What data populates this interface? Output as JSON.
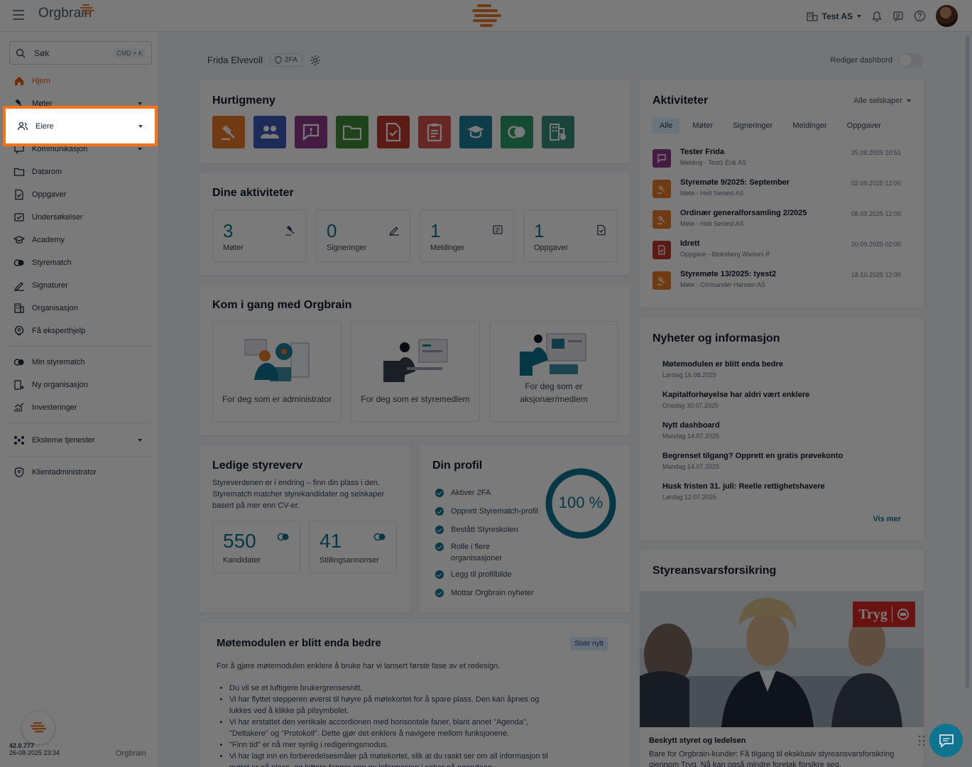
{
  "header": {
    "brand": "Orgbrain",
    "company": "Test AS"
  },
  "sidebar": {
    "search_label": "Søk",
    "search_shortcut": "CMD + K",
    "items": [
      {
        "label": "Hjem"
      },
      {
        "label": "Møter"
      },
      {
        "label": "Eiere"
      },
      {
        "label": "Kommunikasjon"
      },
      {
        "label": "Datarom"
      },
      {
        "label": "Oppgaver"
      },
      {
        "label": "Undersøkelser"
      },
      {
        "label": "Academy"
      },
      {
        "label": "Styrematch"
      },
      {
        "label": "Signaturer"
      },
      {
        "label": "Organisasjon"
      },
      {
        "label": "Få eksperthjelp"
      }
    ],
    "secondary": [
      {
        "label": "Min styrematch"
      },
      {
        "label": "Ny organisasjon"
      },
      {
        "label": "Investeringer"
      }
    ],
    "external": "Eksterne tjenester",
    "client_admin": "Klientadministrator",
    "version": "42.0.777",
    "build_time": "26-08-2025 23:34",
    "footer_brand": "Orgbrain"
  },
  "user": {
    "name": "Frida Elvevoll",
    "twofa": "2FA",
    "edit_dashboard": "Rediger dashbord"
  },
  "quickmenu": {
    "title": "Hurtigmeny",
    "colors": [
      "#ea7b27",
      "#3b5bb8",
      "#8e3a8c",
      "#3f8c3a",
      "#c0392b",
      "#d9534f",
      "#1e7f99",
      "#2a9d6a",
      "#3a8f7f"
    ]
  },
  "my_activities": {
    "title": "Dine aktiviteter",
    "stats": [
      {
        "value": "3",
        "label": "Møter"
      },
      {
        "value": "0",
        "label": "Signeringer"
      },
      {
        "value": "1",
        "label": "Meldinger"
      },
      {
        "value": "1",
        "label": "Oppgaver"
      }
    ]
  },
  "get_started": {
    "title": "Kom i gang med Orgbrain",
    "cards": [
      {
        "label": "For deg som er administrator"
      },
      {
        "label": "For deg som er styremedlem"
      },
      {
        "label": "For deg som er aksjonær/medlem"
      }
    ]
  },
  "board_positions": {
    "title": "Ledige styreverv",
    "text": "Styreverdenen er i endring – finn din plass i den. Styrematch matcher styrekandidater og selskaper basert på mer enn CV-er.",
    "stats": [
      {
        "value": "550",
        "label": "Kandidater"
      },
      {
        "value": "41",
        "label": "Stillingsannonser"
      }
    ]
  },
  "profile": {
    "title": "Din profil",
    "percent": "100 %",
    "progress": 100,
    "items": [
      {
        "label": "Aktiver 2FA"
      },
      {
        "label": "Opprett Styrematch-profil"
      },
      {
        "label": "Bestått Styreskolen"
      },
      {
        "label": "Rolle i flere organisasjoner"
      },
      {
        "label": "Legg til profilbilde"
      },
      {
        "label": "Mottar Orgbrain nyheter"
      }
    ]
  },
  "article": {
    "title": "Møtemodulen er blitt enda bedre",
    "badge": "Siste nytt",
    "intro": "For å gjøre møtemodulen enklere å bruke har vi lansert første fase av et redesign.",
    "bullets": [
      "Du vil se et luftigere brukergrensesnitt.",
      "Vi har flyttet stepperen øverst til høyre på møtekortet for å spare plass. Den kan åpnes og lukkes ved å klikke på pilsymbolet.",
      "Vi har erstattet den vertikale accordionen med horisontale faner, blant annet \"Agenda\", \"Deltakere\" og \"Protokoll\". Dette gjør det enklere å navigere mellom funksjonene.",
      "\"Finn tid\" er nå mer synlig i redigeringsmodus.",
      "Vi har lagt inn en forberedelsesmåler på møtekortet, slik at du raskt ser om all informasjon til møtet er på plass, og lettere fanger opp ny informasjon i saker på agendaen."
    ]
  },
  "activities": {
    "title": "Aktiviteter",
    "filter": "Alle selskaper",
    "tabs": [
      {
        "label": "Alle"
      },
      {
        "label": "Møter"
      },
      {
        "label": "Signeringer"
      },
      {
        "label": "Meldinger"
      },
      {
        "label": "Oppgaver"
      }
    ],
    "items": [
      {
        "title": "Tester Frida",
        "sub": "Melding - Test1 Erik AS",
        "date": "25.08.2025 10:51",
        "color": "#8e3a8c"
      },
      {
        "title": "Styremøte 9/2025: September",
        "sub": "Møte - Helt Seriøst AS",
        "date": "02.09.2025 12:00",
        "color": "#ea7b27"
      },
      {
        "title": "Ordinær generalforsamling 2/2025",
        "sub": "Møte - Helt Seriøst AS",
        "date": "08.09.2025 12:00",
        "color": "#ea7b27"
      },
      {
        "title": "Idrett",
        "sub": "Oppgave - Bloksberg Wariors If",
        "date": "20.09.2025 02:00",
        "color": "#c0392b"
      },
      {
        "title": "Styremøte 13/2025: tyest2",
        "sub": "Møte - Chrisander Hansen AS",
        "date": "18.10.2025 12:00",
        "color": "#ea7b27"
      }
    ]
  },
  "news": {
    "title": "Nyheter og informasjon",
    "more": "Vis mer",
    "items": [
      {
        "title": "Møtemodulen er blitt enda bedre",
        "date": "Lørdag 16.08.2025"
      },
      {
        "title": "Kapitalforhøyelse har aldri vært enklere",
        "date": "Onsdag 30.07.2025"
      },
      {
        "title": "Nytt dashboard",
        "date": "Mandag 14.07.2025"
      },
      {
        "title": "Begrenset tilgang? Opprett en gratis prøvekonto",
        "date": "Mandag 14.07.2025"
      },
      {
        "title": "Husk fristen 31. juli: Reelle rettighetshavere",
        "date": "Lørdag 12.07.2025"
      }
    ]
  },
  "insurance": {
    "title": "Styreansvarsforsikring",
    "partner": "Tryg",
    "headline": "Beskytt styret og ledelsen",
    "text": "Bare for Orgbrain-kunder: Få tilgang til eksklusiv styreansvarsforsikring gjennom Tryg. Nå kan også mindre foretak forsikre seg."
  }
}
